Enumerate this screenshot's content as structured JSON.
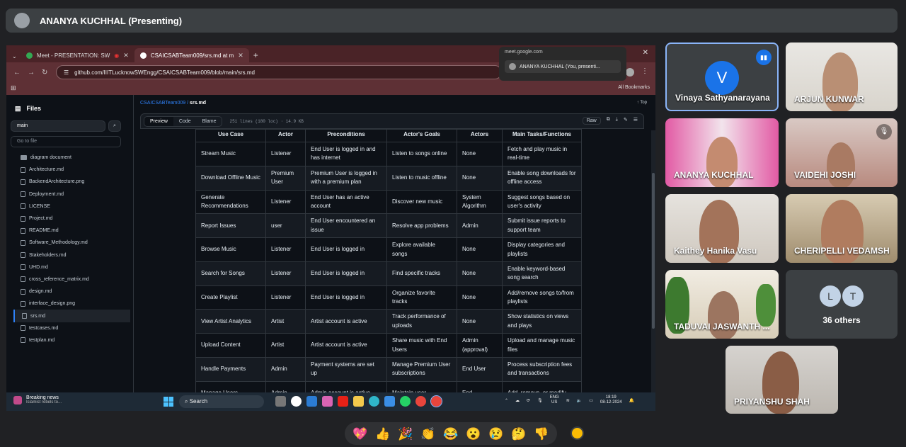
{
  "presenter": {
    "title": "ANANYA KUCHHAL (Presenting)"
  },
  "browser": {
    "tabs": [
      {
        "label": "Meet - PRESENTATION: SW",
        "active": false
      },
      {
        "label": "CSAICSABTeam009/srs.md at m",
        "active": true
      }
    ],
    "url": "github.com/IIITLucknowSWEngg/CSAICSABTeam009/blob/main/srs.md",
    "all_bookmarks": "All Bookmarks",
    "popup": {
      "domain": "meet.google.com",
      "entry": "ANANYA KUCHHAL (You, presenti..."
    }
  },
  "github": {
    "files_title": "Files",
    "branch": "main",
    "go_to_file": "Go to file",
    "tree": [
      {
        "name": "diagram document",
        "folder": true
      },
      {
        "name": "Architecture.md"
      },
      {
        "name": "BackendArchitecture.png"
      },
      {
        "name": "Deployment.md"
      },
      {
        "name": "LICENSE"
      },
      {
        "name": "Project.md"
      },
      {
        "name": "README.md"
      },
      {
        "name": "Software_Methodology.md"
      },
      {
        "name": "Stakeholders.md"
      },
      {
        "name": "UHD.md"
      },
      {
        "name": "cross_reference_matrix.md"
      },
      {
        "name": "design.md"
      },
      {
        "name": "interface_design.png"
      },
      {
        "name": "srs.md",
        "selected": true
      },
      {
        "name": "testcases.md"
      },
      {
        "name": "testplan.md"
      }
    ],
    "breadcrumb_repo": "CSAICSABTeam009",
    "breadcrumb_file": "srs.md",
    "top_link": "Top",
    "view_tabs": [
      "Preview",
      "Code",
      "Blame"
    ],
    "lines_info": "251 lines (180 loc) · 14.9 KB",
    "raw": "Raw",
    "table": {
      "headers": [
        "Use Case",
        "Actor",
        "Preconditions",
        "Actor's Goals",
        "Actors",
        "Main Tasks/Functions"
      ],
      "rows": [
        [
          "Stream Music",
          "Listener",
          "End User is logged in and has internet",
          "Listen to songs online",
          "None",
          "Fetch and play music in real-time"
        ],
        [
          "Download Offline Music",
          "Premium User",
          "Premium User is logged in with a premium plan",
          "Listen to music offline",
          "None",
          "Enable song downloads for offline access"
        ],
        [
          "Generate Recommendations",
          "Listener",
          "End User has an active account",
          "Discover new music",
          "System Algorithm",
          "Suggest songs based on user's activity"
        ],
        [
          "Report Issues",
          "user",
          "End User encountered an issue",
          "Resolve app problems",
          "Admin",
          "Submit issue reports to support team"
        ],
        [
          "Browse Music",
          "Listener",
          "End User is logged in",
          "Explore available songs",
          "None",
          "Display categories and playlists"
        ],
        [
          "Search for Songs",
          "Listener",
          "End User is logged in",
          "Find specific tracks",
          "None",
          "Enable keyword-based song search"
        ],
        [
          "Create Playlist",
          "Listener",
          "End User is logged in",
          "Organize favorite tracks",
          "None",
          "Add/remove songs to/from playlists"
        ],
        [
          "View Artist Analytics",
          "Artist",
          "Artist account is active",
          "Track performance of uploads",
          "None",
          "Show statistics on views and plays"
        ],
        [
          "Upload Content",
          "Artist",
          "Artist account is active",
          "Share music with End Users",
          "Admin (approval)",
          "Upload and manage music files"
        ],
        [
          "Handle Payments",
          "Admin",
          "Payment systems are set up",
          "Manage Premium User subscriptions",
          "End User",
          "Process subscription fees and transactions"
        ],
        [
          "Manage Users",
          "Admin",
          "Admin account is active",
          "Maintain user",
          "End",
          "Add, remove, or modify"
        ]
      ]
    }
  },
  "taskbar": {
    "news_title": "Breaking news",
    "news_sub": "Islamist rebels to...",
    "search": "Search",
    "lang1": "ENG",
    "lang2": "US",
    "time": "18:19",
    "date": "08-12-2024"
  },
  "participants": [
    {
      "name": "Vinaya Sathyanarayana",
      "initial": "V"
    },
    {
      "name": "ARJUN KUNWAR"
    },
    {
      "name": "ANANYA KUCHHAL"
    },
    {
      "name": "VAIDEHI JOSHI"
    },
    {
      "name": "Kaithey Hanika Vasu"
    },
    {
      "name": "CHERIPELLI VEDAMSH"
    },
    {
      "name": "TADUVAI JASWANTH ..."
    },
    {
      "name": "PRIYANSHU SHAH"
    }
  ],
  "others": {
    "initials": [
      "L",
      "T"
    ],
    "label": "36 others"
  },
  "reactions": [
    "💖",
    "👍",
    "🎉",
    "👏",
    "😂",
    "😮",
    "😢",
    "🤔",
    "👎"
  ],
  "colors": {
    "accent": "#1a73e8",
    "active_border": "#8ab4f8",
    "raise_hand": "#fbbc04"
  }
}
